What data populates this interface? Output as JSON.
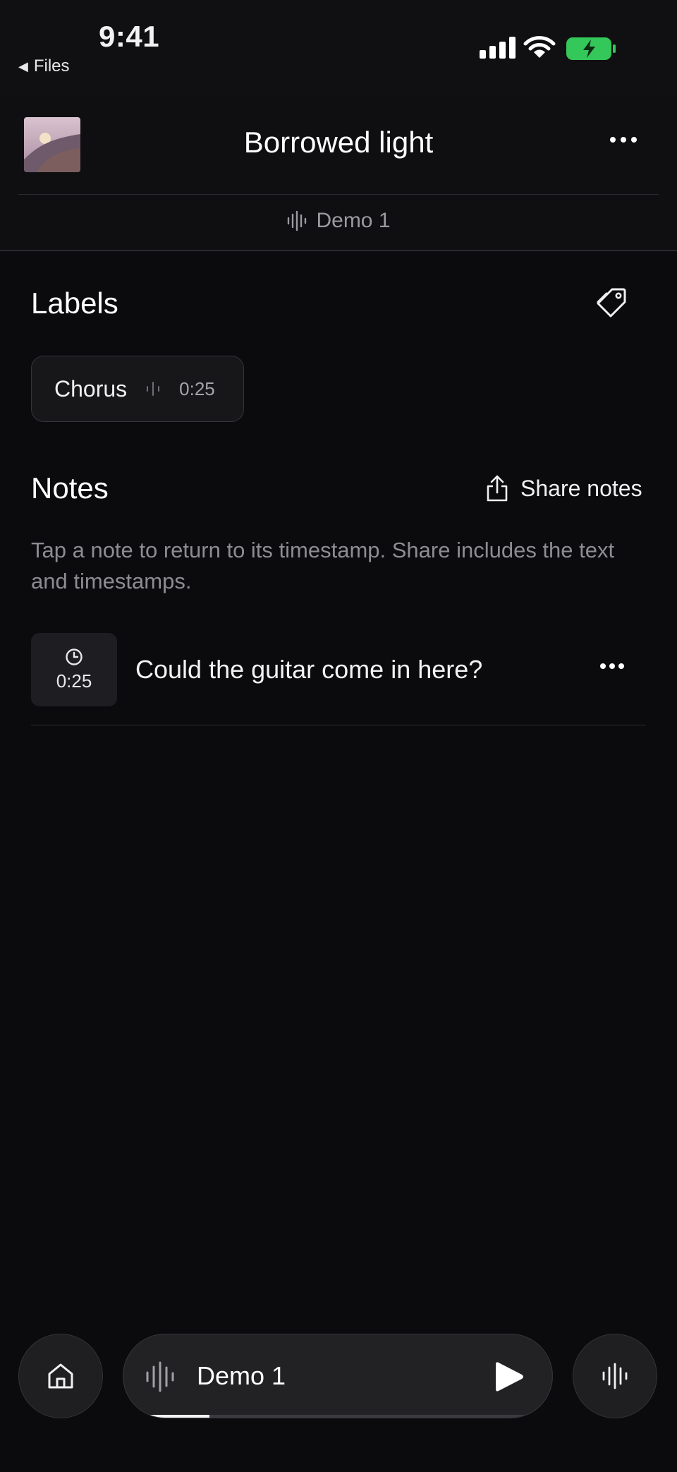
{
  "status_bar": {
    "time": "9:41",
    "back_label": "Files",
    "battery_color": "#34c759"
  },
  "header": {
    "title": "Borrowed light",
    "subtitle": "Demo 1"
  },
  "labels": {
    "section_title": "Labels",
    "items": [
      {
        "name": "Chorus",
        "time": "0:25"
      }
    ]
  },
  "notes": {
    "section_title": "Notes",
    "share_label": "Share notes",
    "hint": "Tap a note to return to its timestamp. Share includes the text and timestamps.",
    "items": [
      {
        "time": "0:25",
        "text": "Could the guitar come in here?"
      }
    ]
  },
  "player": {
    "title": "Demo 1",
    "progress": 0.17
  },
  "icons": [
    "back-triangle-icon",
    "signal-icon",
    "wifi-icon",
    "battery-charging-icon",
    "more-icon",
    "waveform-icon",
    "tag-icon",
    "share-icon",
    "clock-icon",
    "home-icon",
    "play-icon"
  ]
}
